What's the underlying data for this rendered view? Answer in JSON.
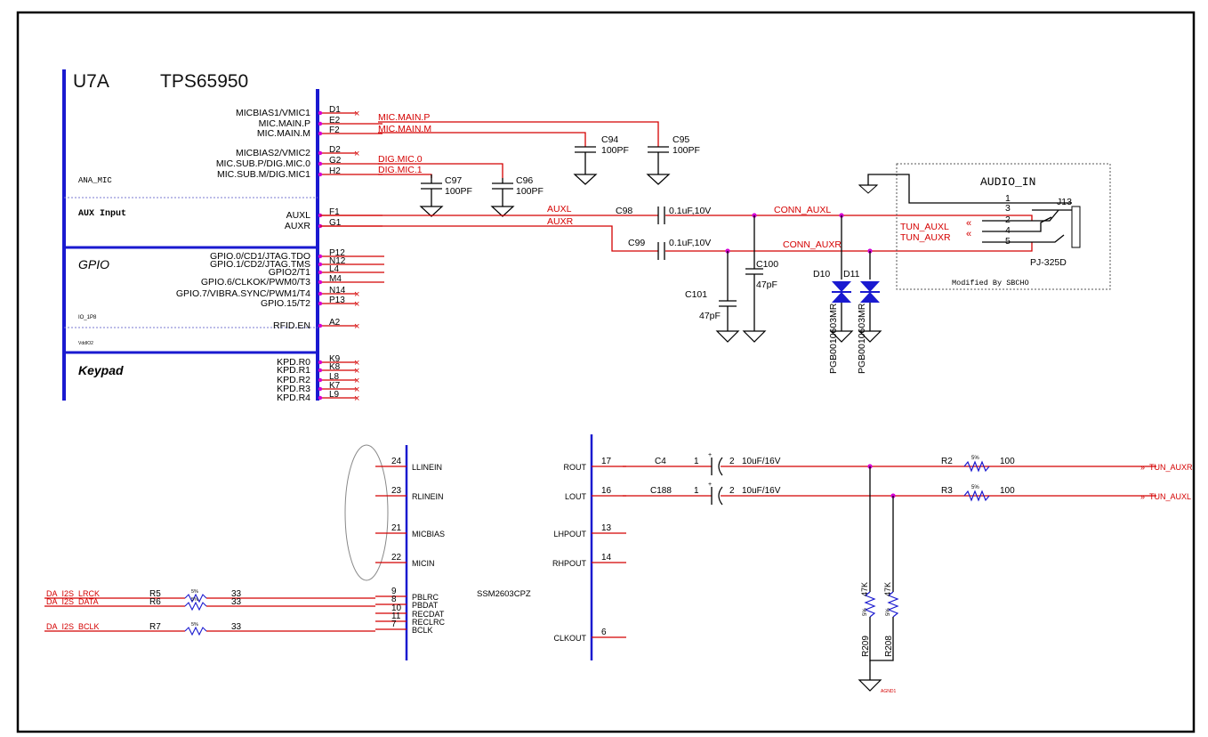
{
  "u7a": {
    "ref": "U7A",
    "part": "TPS65950",
    "sections": {
      "ana_mic": "ANA_MIC",
      "aux_input": "AUX Input",
      "gpio": "GPIO",
      "io_1p8": "IO_1P8",
      "vdd": "VddIO2",
      "keypad": "Keypad"
    },
    "pins": [
      {
        "signal": "MICBIAS1/VMIC1",
        "pin": "D1",
        "net": ""
      },
      {
        "signal": "MIC.MAIN.P",
        "pin": "E2",
        "net": "MIC.MAIN.P"
      },
      {
        "signal": "MIC.MAIN.M",
        "pin": "F2",
        "net": "MIC.MAIN.M"
      },
      {
        "signal": "MICBIAS2/VMIC2",
        "pin": "D2",
        "net": ""
      },
      {
        "signal": "MIC.SUB.P/DIG.MIC.0",
        "pin": "G2",
        "net": "DIG.MIC.0"
      },
      {
        "signal": "MIC.SUB.M/DIG.MIC1",
        "pin": "H2",
        "net": "DIG.MIC.1"
      },
      {
        "signal": "AUXL",
        "pin": "F1",
        "net": "AUXL"
      },
      {
        "signal": "AUXR",
        "pin": "G1",
        "net": "AUXR"
      },
      {
        "signal": "GPIO.0/CD1/JTAG.TDO",
        "pin": "P12",
        "net": ""
      },
      {
        "signal": "GPIO.1/CD2/JTAG.TMS",
        "pin": "N12",
        "net": ""
      },
      {
        "signal": "GPIO2/T1",
        "pin": "L4",
        "net": ""
      },
      {
        "signal": "GPIO.6/CLKOK/PWM0/T3",
        "pin": "M4",
        "net": ""
      },
      {
        "signal": "GPIO.7/VIBRA.SYNC/PWM1/T4",
        "pin": "N14",
        "net": ""
      },
      {
        "signal": "GPIO.15/T2",
        "pin": "P13",
        "net": ""
      },
      {
        "signal": "RFID.EN",
        "pin": "A2",
        "net": ""
      },
      {
        "signal": "KPD.R0",
        "pin": "K9",
        "net": ""
      },
      {
        "signal": "KPD.R1",
        "pin": "K8",
        "net": ""
      },
      {
        "signal": "KPD.R2",
        "pin": "L8",
        "net": ""
      },
      {
        "signal": "KPD.R3",
        "pin": "K7",
        "net": ""
      },
      {
        "signal": "KPD.R4",
        "pin": "L9",
        "net": ""
      }
    ]
  },
  "caps_top": [
    {
      "ref": "C94",
      "value": "100PF"
    },
    {
      "ref": "C95",
      "value": "100PF"
    },
    {
      "ref": "C97",
      "value": "100PF"
    },
    {
      "ref": "C96",
      "value": "100PF"
    },
    {
      "ref": "C98",
      "value": "0.1uF,10V"
    },
    {
      "ref": "C99",
      "value": "0.1uF,10V"
    },
    {
      "ref": "C100",
      "value": "47pF"
    },
    {
      "ref": "C101",
      "value": "47pF"
    }
  ],
  "nets_top": {
    "conn_auxl": "CONN_AUXL",
    "conn_auxr": "CONN_AUXR",
    "tun_auxl": "TUN_AUXL",
    "tun_auxr": "TUN_AUXR"
  },
  "diodes": {
    "d10": "D10",
    "d11": "D11",
    "part_a": "PGB0010603MR",
    "part_b": "PGB0010603MR"
  },
  "connector": {
    "title": "AUDIO_IN",
    "ref": "J13",
    "pins": [
      "1",
      "3",
      "2",
      "4",
      "5"
    ],
    "part": "PJ-325D",
    "note": "Modified By SBCHO"
  },
  "ssm": {
    "part": "SSM2603CPZ",
    "left_pins": [
      {
        "num": "24",
        "name": "LLINEIN"
      },
      {
        "num": "23",
        "name": "RLINEIN"
      },
      {
        "num": "21",
        "name": "MICBIAS"
      },
      {
        "num": "22",
        "name": "MICIN"
      },
      {
        "num": "9",
        "name": "PBLRC"
      },
      {
        "num": "8",
        "name": "PBDAT"
      },
      {
        "num": "10",
        "name": "RECDAT"
      },
      {
        "num": "11",
        "name": "RECLRC"
      },
      {
        "num": "7",
        "name": "BCLK"
      }
    ],
    "right_pins": [
      {
        "num": "17",
        "name": "ROUT"
      },
      {
        "num": "16",
        "name": "LOUT"
      },
      {
        "num": "13",
        "name": "LHPOUT"
      },
      {
        "num": "14",
        "name": "RHPOUT"
      },
      {
        "num": "6",
        "name": "CLKOUT"
      }
    ]
  },
  "i2s": [
    {
      "net": "DA_I2S_LRCK",
      "ref": "R5",
      "value": "33",
      "tol": "5%"
    },
    {
      "net": "DA_I2S_DATA",
      "ref": "R6",
      "value": "33",
      "tol": "5%"
    },
    {
      "net": "DA_I2S_BCLK",
      "ref": "R7",
      "value": "33",
      "tol": "5%"
    }
  ],
  "outputs": [
    {
      "cap": "C4",
      "cap_pins": [
        "1",
        "2"
      ],
      "cap_value": "10uF/16V",
      "res": "R2",
      "res_tol": "5%",
      "res_value": "100",
      "net": "TUN_AUXR"
    },
    {
      "cap": "C188",
      "cap_pins": [
        "1",
        "2"
      ],
      "cap_value": "10uF/16V",
      "res": "R3",
      "res_tol": "5%",
      "res_value": "100",
      "net": "TUN_AUXL"
    }
  ],
  "pulldowns": [
    {
      "ref": "R209",
      "value": "47K",
      "tol": "5%"
    },
    {
      "ref": "R208",
      "value": "47K",
      "tol": "5%"
    }
  ],
  "ground_label": "AGND1"
}
